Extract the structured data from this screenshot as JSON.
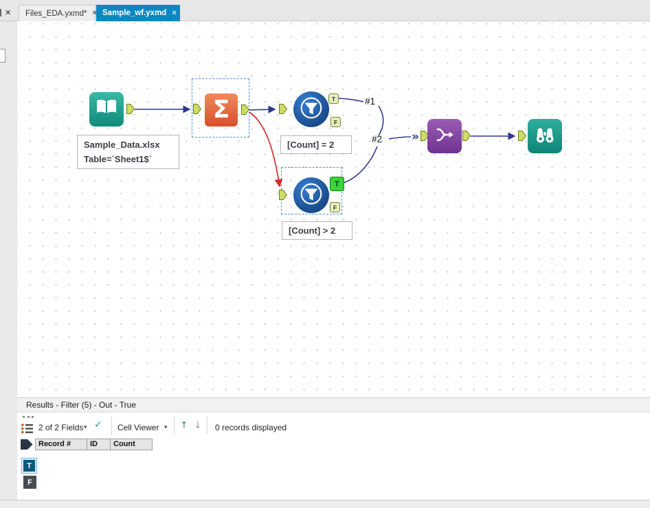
{
  "tab_bar": {
    "overflow_close": "✕",
    "tabs": [
      {
        "label": "Files_EDA.yxmd*",
        "close": "✕"
      },
      {
        "label": "Sample_wf.yxmd",
        "close": "✕"
      }
    ]
  },
  "canvas": {
    "summarize_glyph": "Σ",
    "input_annotation": {
      "line1": "Sample_Data.xlsx",
      "line2": "Table=`Sheet1$`"
    },
    "filter_top_annotation": "[Count] = 2",
    "filter_bottom_annotation": "[Count] > 2",
    "connection_labels": {
      "c1": "#1",
      "c2": "#2"
    },
    "anchors": {
      "t": "T",
      "f": "F"
    },
    "union_input_marker": "»"
  },
  "results": {
    "title": "Results - Filter (5) - Out - True",
    "toolbar": {
      "fields_dropdown": "2 of 2 Fields",
      "caret": "▾",
      "check": "✓",
      "cell_viewer_dropdown": "Cell Viewer",
      "up_arrow": "↑",
      "down_arrow": "↓",
      "records_text": "0 records displayed"
    },
    "columns": [
      "Record #",
      "ID",
      "Count"
    ],
    "output_tabs": {
      "t": "T",
      "f": "F"
    }
  }
}
